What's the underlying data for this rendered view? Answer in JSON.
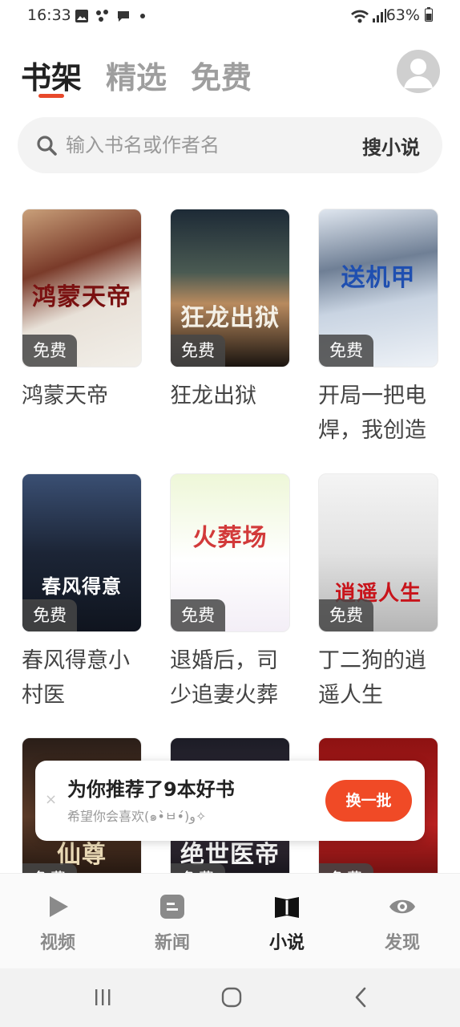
{
  "status": {
    "time": "16:33",
    "battery": "63%"
  },
  "tabs": [
    {
      "label": "书架",
      "active": true
    },
    {
      "label": "精选",
      "active": false
    },
    {
      "label": "免费",
      "active": false
    }
  ],
  "search": {
    "placeholder": "输入书名或作者名",
    "button": "搜小说"
  },
  "books": [
    {
      "title": "鸿蒙天帝",
      "cover_text": "鸿蒙天帝",
      "badge": "免费"
    },
    {
      "title": "狂龙出狱",
      "cover_text": "狂龙出狱",
      "badge": "免费"
    },
    {
      "title": "开局一把电焊，我创造",
      "cover_text": "送机甲",
      "badge": "免费"
    },
    {
      "title": "春风得意小村医",
      "cover_text": "春风得意",
      "badge": "免费"
    },
    {
      "title": "退婚后，司少追妻火葬",
      "cover_text": "火葬场",
      "badge": "免费"
    },
    {
      "title": "丁二狗的逍遥人生",
      "cover_text": "逍遥人生",
      "badge": "免费"
    },
    {
      "title": "",
      "cover_text": "仙尊",
      "badge": "免费"
    },
    {
      "title": "",
      "cover_text": "绝世医帝",
      "badge": "免费"
    },
    {
      "title": "",
      "cover_text": "",
      "badge": "免费"
    }
  ],
  "recommendation": {
    "title": "为你推荐了9本好书",
    "subtitle": "希望你会喜欢(๑•̀ㅂ•́)و✧",
    "button": "换一批",
    "close": "×"
  },
  "bottom_nav": [
    {
      "label": "视频",
      "icon": "play-icon",
      "active": false
    },
    {
      "label": "新闻",
      "icon": "news-icon",
      "active": false
    },
    {
      "label": "小说",
      "icon": "book-icon",
      "active": true
    },
    {
      "label": "发现",
      "icon": "eye-icon",
      "active": false
    }
  ],
  "colors": {
    "accent": "#f04a26",
    "indicator": "#e8492b"
  }
}
